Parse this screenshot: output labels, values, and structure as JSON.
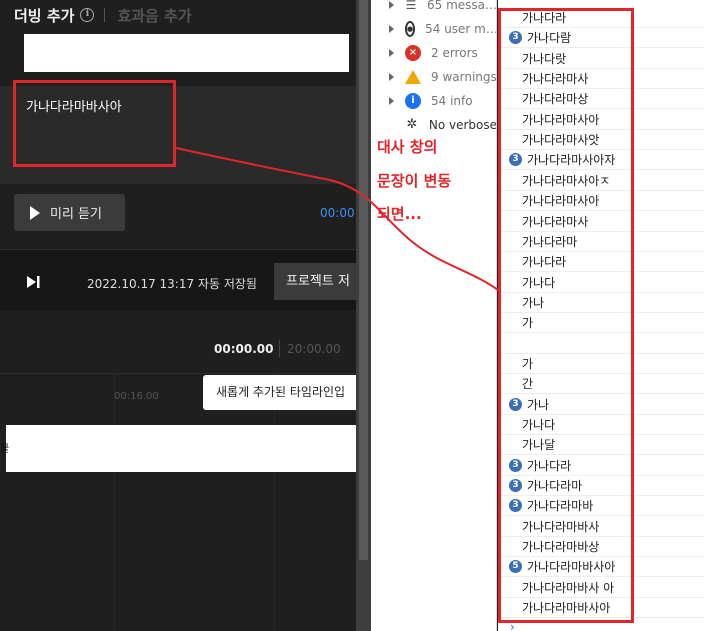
{
  "app": {
    "tab_active": "더빙 추가",
    "tab_inactive": "효과음 추가",
    "dialog_text": "가나다라마바사아",
    "preview_button": "미리 듣기",
    "time_blue": "00:00",
    "autosave": "2022.10.17 13:17 자동 저장됨",
    "project_button": "프로젝트 저",
    "time_current": "00:00.00",
    "time_total": "20:00.00",
    "ruler_label": "00:16.00",
    "tooltip": "새롭게 추가된 타임라인입",
    "track_edge": "뭍"
  },
  "devtools": {
    "sidebar": [
      {
        "label": "65 messa…",
        "icon": "list-icon",
        "color": "#555555"
      },
      {
        "label": "54 user m…",
        "icon": "user-icon",
        "color": "#333333"
      },
      {
        "label": "2 errors",
        "icon": "error-icon",
        "color": "#d93025"
      },
      {
        "label": "9 warnings",
        "icon": "warning-icon",
        "color": "#f2a600"
      },
      {
        "label": "54 info",
        "icon": "info-icon",
        "color": "#1a73e8"
      },
      {
        "label": "No verbose",
        "icon": "bug-icon",
        "color": "#333333"
      }
    ],
    "console_rows": [
      {
        "count": "",
        "text": "가나다라"
      },
      {
        "count": "3",
        "text": "가나다람"
      },
      {
        "count": "",
        "text": "가나다랏"
      },
      {
        "count": "",
        "text": "가나다라마사"
      },
      {
        "count": "",
        "text": "가나다라마상"
      },
      {
        "count": "",
        "text": "가나다라마사아"
      },
      {
        "count": "",
        "text": "가나다라마사앗"
      },
      {
        "count": "3",
        "text": "가나다라마사아자"
      },
      {
        "count": "",
        "text": "가나다라마사아ㅈ"
      },
      {
        "count": "",
        "text": "가나다라마사아"
      },
      {
        "count": "",
        "text": "가나다라마사"
      },
      {
        "count": "",
        "text": "가나다라마"
      },
      {
        "count": "",
        "text": "가나다라"
      },
      {
        "count": "",
        "text": "가나다"
      },
      {
        "count": "",
        "text": "가나"
      },
      {
        "count": "",
        "text": "가"
      },
      {
        "count": "",
        "text": ""
      },
      {
        "count": "",
        "text": "가"
      },
      {
        "count": "",
        "text": "간"
      },
      {
        "count": "3",
        "text": "가나"
      },
      {
        "count": "",
        "text": "가나다"
      },
      {
        "count": "",
        "text": "가나달"
      },
      {
        "count": "3",
        "text": "가나다라"
      },
      {
        "count": "3",
        "text": "가나다라마"
      },
      {
        "count": "3",
        "text": "가나다라마바"
      },
      {
        "count": "",
        "text": "가나다라마바사"
      },
      {
        "count": "",
        "text": "가나다라마바상"
      },
      {
        "count": "5",
        "text": "가나다라마바사아"
      },
      {
        "count": "",
        "text": "가나다라마바사 아"
      },
      {
        "count": "",
        "text": "가나다라마바사아"
      }
    ]
  },
  "annotation": {
    "lines": [
      "대사 창의",
      "문장이 변동",
      "되면..."
    ],
    "color": "#e0262b"
  }
}
